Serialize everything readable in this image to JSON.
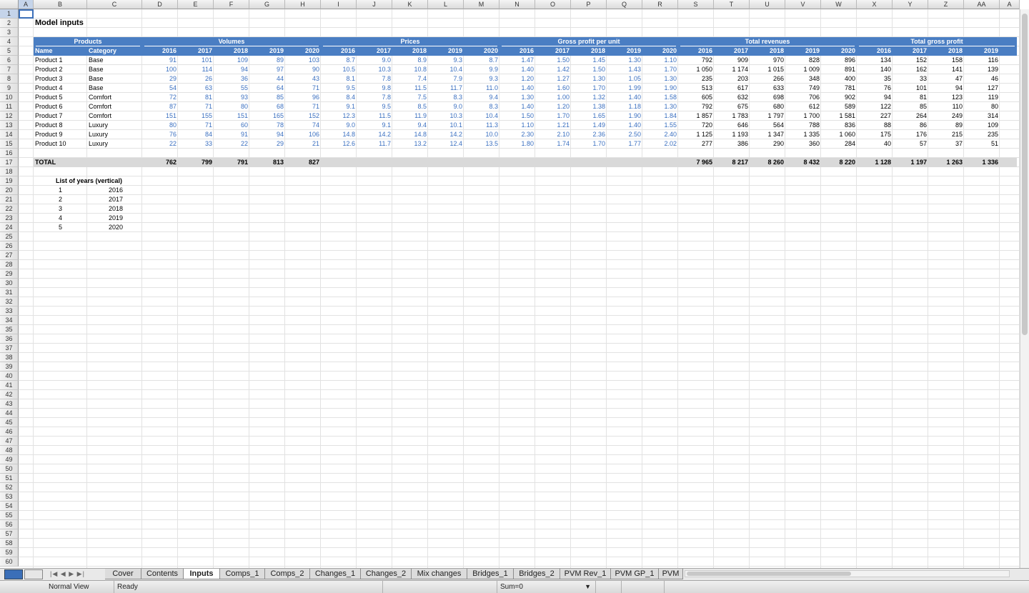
{
  "sheet": {
    "title": "Model inputs",
    "columns": [
      "A",
      "B",
      "C",
      "D",
      "E",
      "F",
      "G",
      "H",
      "I",
      "J",
      "K",
      "L",
      "M",
      "N",
      "O",
      "P",
      "Q",
      "R",
      "S",
      "T",
      "U",
      "V",
      "W",
      "X",
      "Y",
      "Z",
      "AA",
      "A"
    ],
    "rows": [
      "1",
      "2",
      "3",
      "4",
      "5",
      "6",
      "7",
      "8",
      "9",
      "10",
      "11",
      "12",
      "13",
      "14",
      "15",
      "16",
      "17",
      "18",
      "19",
      "20",
      "21",
      "22",
      "23",
      "24",
      "25",
      "26",
      "27",
      "28",
      "29",
      "30",
      "31",
      "32",
      "33",
      "34",
      "35",
      "36",
      "37",
      "38",
      "39",
      "40",
      "41",
      "42",
      "43",
      "44",
      "45",
      "46",
      "47",
      "48",
      "49",
      "50",
      "51",
      "52",
      "53",
      "54",
      "55",
      "56",
      "57",
      "58",
      "59",
      "60"
    ],
    "sections": [
      "Products",
      "Volumes",
      "Prices",
      "Gross profit per unit",
      "Total revenues",
      "Total gross profit"
    ],
    "col_labels": [
      "Name",
      "Category"
    ],
    "years": [
      "2016",
      "2017",
      "2018",
      "2019",
      "2020"
    ],
    "years_last": [
      "2016",
      "2017",
      "2018",
      "2019"
    ],
    "products": [
      {
        "name": "Product 1",
        "category": "Base",
        "vol": [
          "91",
          "101",
          "109",
          "89",
          "103"
        ],
        "price": [
          "8.7",
          "9.0",
          "8.9",
          "9.3",
          "8.7"
        ],
        "gp": [
          "1.47",
          "1.50",
          "1.45",
          "1.30",
          "1.10"
        ],
        "rev": [
          "792",
          "909",
          "970",
          "828",
          "896"
        ],
        "tgp": [
          "134",
          "152",
          "158",
          "116"
        ]
      },
      {
        "name": "Product 2",
        "category": "Base",
        "vol": [
          "100",
          "114",
          "94",
          "97",
          "90"
        ],
        "price": [
          "10.5",
          "10.3",
          "10.8",
          "10.4",
          "9.9"
        ],
        "gp": [
          "1.40",
          "1.42",
          "1.50",
          "1.43",
          "1.70"
        ],
        "rev": [
          "1 050",
          "1 174",
          "1 015",
          "1 009",
          "891"
        ],
        "tgp": [
          "140",
          "162",
          "141",
          "139"
        ]
      },
      {
        "name": "Product 3",
        "category": "Base",
        "vol": [
          "29",
          "26",
          "36",
          "44",
          "43"
        ],
        "price": [
          "8.1",
          "7.8",
          "7.4",
          "7.9",
          "9.3"
        ],
        "gp": [
          "1.20",
          "1.27",
          "1.30",
          "1.05",
          "1.30"
        ],
        "rev": [
          "235",
          "203",
          "266",
          "348",
          "400"
        ],
        "tgp": [
          "35",
          "33",
          "47",
          "46"
        ]
      },
      {
        "name": "Product 4",
        "category": "Base",
        "vol": [
          "54",
          "63",
          "55",
          "64",
          "71"
        ],
        "price": [
          "9.5",
          "9.8",
          "11.5",
          "11.7",
          "11.0"
        ],
        "gp": [
          "1.40",
          "1.60",
          "1.70",
          "1.99",
          "1.90"
        ],
        "rev": [
          "513",
          "617",
          "633",
          "749",
          "781"
        ],
        "tgp": [
          "76",
          "101",
          "94",
          "127"
        ]
      },
      {
        "name": "Product 5",
        "category": "Comfort",
        "vol": [
          "72",
          "81",
          "93",
          "85",
          "96"
        ],
        "price": [
          "8.4",
          "7.8",
          "7.5",
          "8.3",
          "9.4"
        ],
        "gp": [
          "1.30",
          "1.00",
          "1.32",
          "1.40",
          "1.58"
        ],
        "rev": [
          "605",
          "632",
          "698",
          "706",
          "902"
        ],
        "tgp": [
          "94",
          "81",
          "123",
          "119"
        ]
      },
      {
        "name": "Product 6",
        "category": "Comfort",
        "vol": [
          "87",
          "71",
          "80",
          "68",
          "71"
        ],
        "price": [
          "9.1",
          "9.5",
          "8.5",
          "9.0",
          "8.3"
        ],
        "gp": [
          "1.40",
          "1.20",
          "1.38",
          "1.18",
          "1.30"
        ],
        "rev": [
          "792",
          "675",
          "680",
          "612",
          "589"
        ],
        "tgp": [
          "122",
          "85",
          "110",
          "80"
        ]
      },
      {
        "name": "Product 7",
        "category": "Comfort",
        "vol": [
          "151",
          "155",
          "151",
          "165",
          "152"
        ],
        "price": [
          "12.3",
          "11.5",
          "11.9",
          "10.3",
          "10.4"
        ],
        "gp": [
          "1.50",
          "1.70",
          "1.65",
          "1.90",
          "1.84"
        ],
        "rev": [
          "1 857",
          "1 783",
          "1 797",
          "1 700",
          "1 581"
        ],
        "tgp": [
          "227",
          "264",
          "249",
          "314"
        ]
      },
      {
        "name": "Product 8",
        "category": "Luxury",
        "vol": [
          "80",
          "71",
          "60",
          "78",
          "74"
        ],
        "price": [
          "9.0",
          "9.1",
          "9.4",
          "10.1",
          "11.3"
        ],
        "gp": [
          "1.10",
          "1.21",
          "1.49",
          "1.40",
          "1.55"
        ],
        "rev": [
          "720",
          "646",
          "564",
          "788",
          "836"
        ],
        "tgp": [
          "88",
          "86",
          "89",
          "109"
        ]
      },
      {
        "name": "Product 9",
        "category": "Luxury",
        "vol": [
          "76",
          "84",
          "91",
          "94",
          "106"
        ],
        "price": [
          "14.8",
          "14.2",
          "14.8",
          "14.2",
          "10.0"
        ],
        "gp": [
          "2.30",
          "2.10",
          "2.36",
          "2.50",
          "2.40"
        ],
        "rev": [
          "1 125",
          "1 193",
          "1 347",
          "1 335",
          "1 060"
        ],
        "tgp": [
          "175",
          "176",
          "215",
          "235"
        ]
      },
      {
        "name": "Product 10",
        "category": "Luxury",
        "vol": [
          "22",
          "33",
          "22",
          "29",
          "21"
        ],
        "price": [
          "12.6",
          "11.7",
          "13.2",
          "12.4",
          "13.5"
        ],
        "gp": [
          "1.80",
          "1.74",
          "1.70",
          "1.77",
          "2.02"
        ],
        "rev": [
          "277",
          "386",
          "290",
          "360",
          "284"
        ],
        "tgp": [
          "40",
          "57",
          "37",
          "51"
        ]
      }
    ],
    "total": {
      "label": "TOTAL",
      "vol": [
        "762",
        "799",
        "791",
        "813",
        "827"
      ],
      "rev": [
        "7 965",
        "8 217",
        "8 260",
        "8 432",
        "8 220"
      ],
      "tgp": [
        "1 128",
        "1 197",
        "1 263",
        "1 336"
      ]
    },
    "year_list": {
      "title": "List of years (vertical)",
      "items": [
        [
          "1",
          "2016"
        ],
        [
          "2",
          "2017"
        ],
        [
          "3",
          "2018"
        ],
        [
          "4",
          "2019"
        ],
        [
          "5",
          "2020"
        ]
      ]
    }
  },
  "tabs": [
    "Cover",
    "Contents",
    "Inputs",
    "Comps_1",
    "Comps_2",
    "Changes_1",
    "Changes_2",
    "Mix changes",
    "Bridges_1",
    "Bridges_2",
    "PVM Rev_1",
    "PVM GP_1",
    "PVM"
  ],
  "active_tab": "Inputs",
  "status": {
    "view": "Normal View",
    "state": "Ready",
    "sum": "Sum=0"
  },
  "colors": {
    "header_blue": "#4a7ec3",
    "input_blue": "#3a6fc0",
    "total_gray": "#d9d9d9"
  }
}
